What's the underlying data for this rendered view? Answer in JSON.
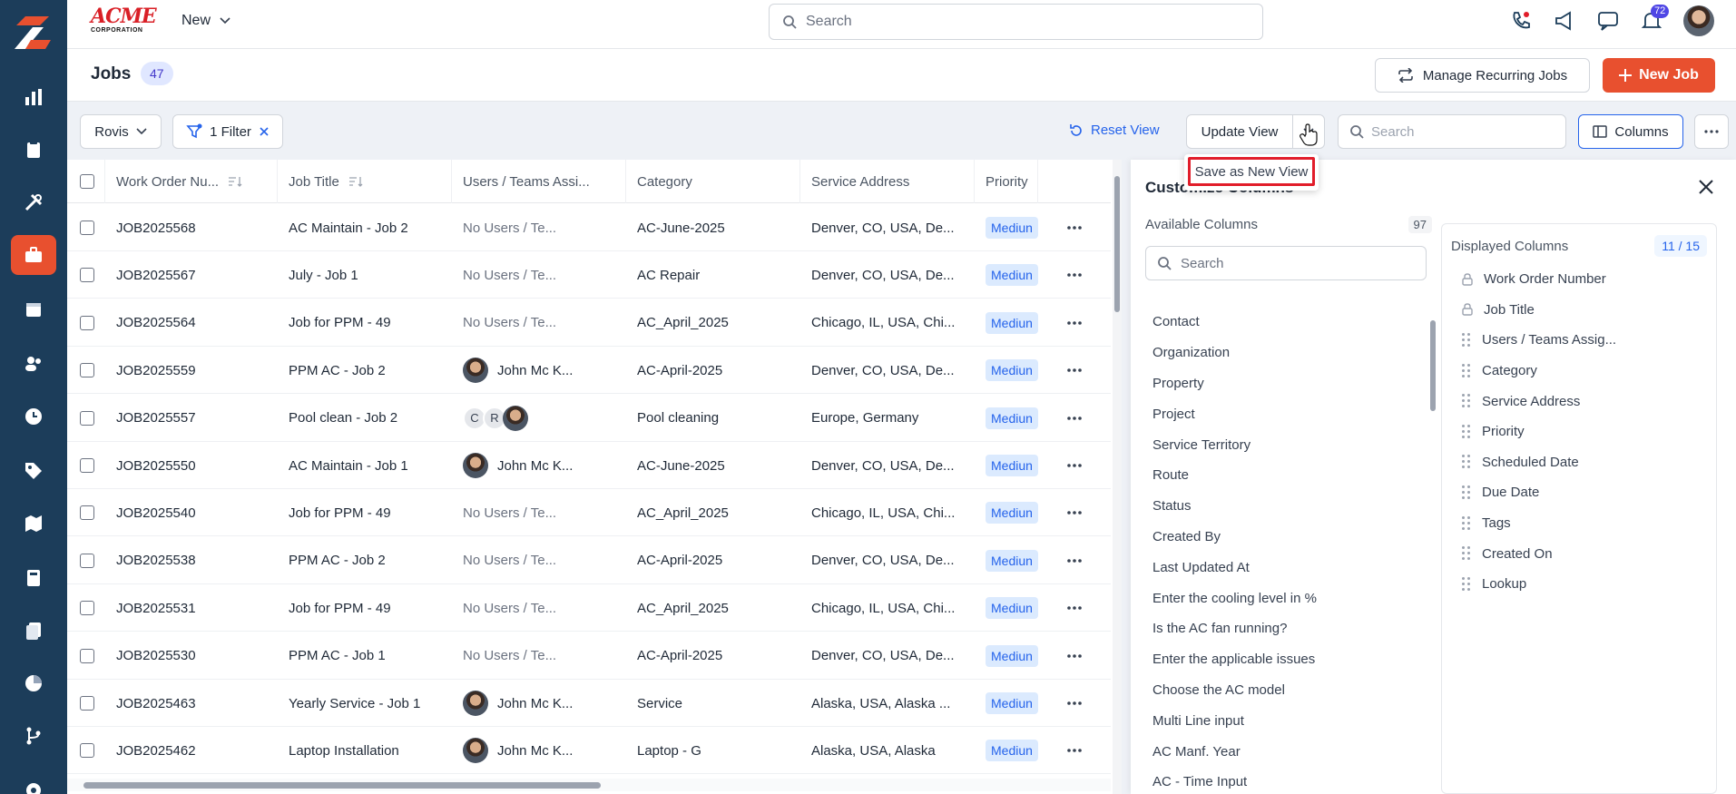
{
  "brand": {
    "logo_text": "ACME",
    "logo_sub": "CORPORATION"
  },
  "topbar": {
    "new_label": "New",
    "search_placeholder": "Search",
    "notification_count": "72"
  },
  "page": {
    "title": "Jobs",
    "count": "47",
    "manage_recurring_label": "Manage Recurring Jobs",
    "new_job_label": "New Job"
  },
  "toolbar": {
    "view_select": "Rovis",
    "filter_label": "1 Filter",
    "reset_view_label": "Reset View",
    "update_view_label": "Update View",
    "search_placeholder": "Search",
    "columns_label": "Columns",
    "save_as_new_view_label": "Save as New View"
  },
  "table": {
    "headers": {
      "work_order": "Work Order Nu...",
      "job_title": "Job Title",
      "users": "Users / Teams Assi...",
      "category": "Category",
      "address": "Service Address",
      "priority": "Priority"
    },
    "rows": [
      {
        "wo": "JOB2025568",
        "title": "AC Maintain - Job 2",
        "users": "No Users / Te...",
        "category": "AC-June-2025",
        "address": "Denver, CO, USA, De...",
        "priority": "Mediun"
      },
      {
        "wo": "JOB2025567",
        "title": "July - Job 1",
        "users": "No Users / Te...",
        "category": "AC Repair",
        "address": "Denver, CO, USA, De...",
        "priority": "Mediun"
      },
      {
        "wo": "JOB2025564",
        "title": "Job for PPM - 49",
        "users": "No Users / Te...",
        "category": "AC_April_2025",
        "address": "Chicago, IL, USA, Chi...",
        "priority": "Mediun"
      },
      {
        "wo": "JOB2025559",
        "title": "PPM AC - Job 2",
        "users": "John Mc K...",
        "category": "AC-April-2025",
        "address": "Denver, CO, USA, De...",
        "priority": "Mediun"
      },
      {
        "wo": "JOB2025557",
        "title": "Pool clean - Job 2",
        "users": "",
        "category": "Pool cleaning",
        "address": "Europe, Germany",
        "priority": "Mediun"
      },
      {
        "wo": "JOB2025550",
        "title": "AC Maintain - Job 1",
        "users": "John Mc K...",
        "category": "AC-June-2025",
        "address": "Denver, CO, USA, De...",
        "priority": "Mediun"
      },
      {
        "wo": "JOB2025540",
        "title": "Job for PPM - 49",
        "users": "No Users / Te...",
        "category": "AC_April_2025",
        "address": "Chicago, IL, USA, Chi...",
        "priority": "Mediun"
      },
      {
        "wo": "JOB2025538",
        "title": "PPM AC - Job 2",
        "users": "No Users / Te...",
        "category": "AC-April-2025",
        "address": "Denver, CO, USA, De...",
        "priority": "Mediun"
      },
      {
        "wo": "JOB2025531",
        "title": "Job for PPM - 49",
        "users": "No Users / Te...",
        "category": "AC_April_2025",
        "address": "Chicago, IL, USA, Chi...",
        "priority": "Mediun"
      },
      {
        "wo": "JOB2025530",
        "title": "PPM AC - Job 1",
        "users": "No Users / Te...",
        "category": "AC-April-2025",
        "address": "Denver, CO, USA, De...",
        "priority": "Mediun"
      },
      {
        "wo": "JOB2025463",
        "title": "Yearly Service - Job 1",
        "users": "John Mc K...",
        "category": "Service",
        "address": "Alaska, USA, Alaska ...",
        "priority": "Mediun"
      },
      {
        "wo": "JOB2025462",
        "title": "Laptop Installation",
        "users": "John Mc K...",
        "category": "Laptop - G",
        "address": "Alaska, USA, Alaska",
        "priority": "Mediun"
      }
    ],
    "pool_initials": [
      "C",
      "R"
    ]
  },
  "customize": {
    "title": "Customize Columns",
    "available_label": "Available Columns",
    "available_count": "97",
    "search_placeholder": "Search",
    "available": [
      "Contact",
      "Organization",
      "Property",
      "Project",
      "Service Territory",
      "Route",
      "Status",
      "Created By",
      "Last Updated At",
      "Enter the cooling level in %",
      "Is the AC fan running?",
      "Enter the applicable issues",
      "Choose the AC model",
      "Multi Line input",
      "AC Manf. Year",
      "AC - Time Input"
    ],
    "displayed_label": "Displayed Columns",
    "displayed_count": "11 / 15",
    "displayed": [
      {
        "label": "Work Order Number",
        "locked": true
      },
      {
        "label": "Job Title",
        "locked": true
      },
      {
        "label": "Users / Teams Assig...",
        "locked": false
      },
      {
        "label": "Category",
        "locked": false
      },
      {
        "label": "Service Address",
        "locked": false
      },
      {
        "label": "Priority",
        "locked": false
      },
      {
        "label": "Scheduled Date",
        "locked": false
      },
      {
        "label": "Due Date",
        "locked": false
      },
      {
        "label": "Tags",
        "locked": false
      },
      {
        "label": "Created On",
        "locked": false
      },
      {
        "label": "Lookup",
        "locked": false
      }
    ]
  }
}
